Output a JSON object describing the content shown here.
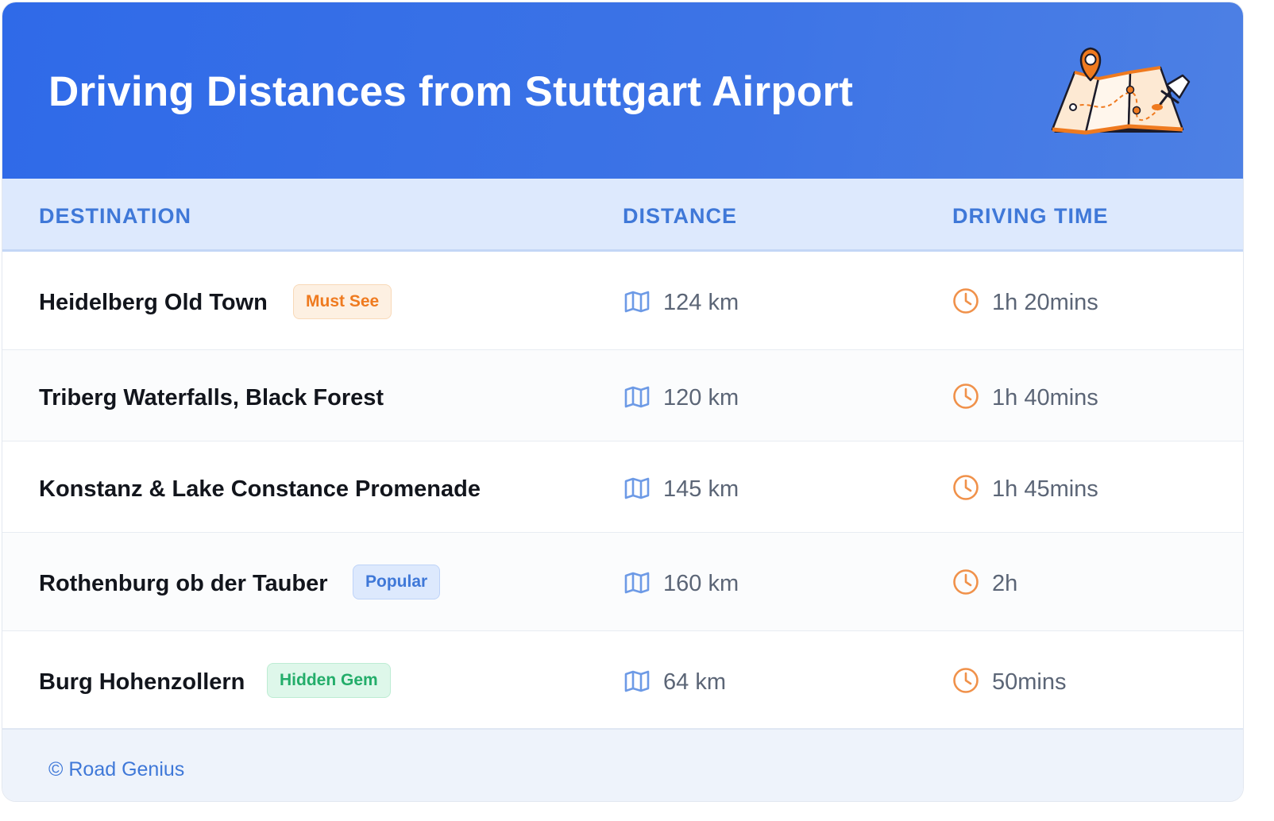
{
  "title": "Driving Distances from Stuttgart Airport",
  "header_icon": "folded-map-with-pins-icon",
  "columns": {
    "destination": "DESTINATION",
    "distance": "DISTANCE",
    "driving_time": "DRIVING TIME"
  },
  "rows": [
    {
      "destination": "Heidelberg Old Town",
      "badge": "Must See",
      "badge_color": "orange",
      "distance": "124 km",
      "time": "1h 20mins"
    },
    {
      "destination": "Triberg Waterfalls, Black Forest",
      "badge": "",
      "badge_color": "",
      "distance": "120 km",
      "time": "1h 40mins"
    },
    {
      "destination": "Konstanz & Lake Constance Promenade",
      "badge": "",
      "badge_color": "",
      "distance": "145 km",
      "time": "1h 45mins"
    },
    {
      "destination": "Rothenburg ob der Tauber",
      "badge": "Popular",
      "badge_color": "blue",
      "distance": "160 km",
      "time": "2h"
    },
    {
      "destination": "Burg Hohenzollern",
      "badge": "Hidden Gem",
      "badge_color": "green",
      "distance": "64 km",
      "time": "50mins"
    }
  ],
  "footer": "© Road Genius",
  "colors": {
    "header_gradient_start": "#2f6ae8",
    "header_gradient_end": "#4d80e4",
    "accent_blue": "#3f78d8",
    "clock_orange": "#f0914a",
    "map_icon_blue": "#6d9ae6"
  }
}
